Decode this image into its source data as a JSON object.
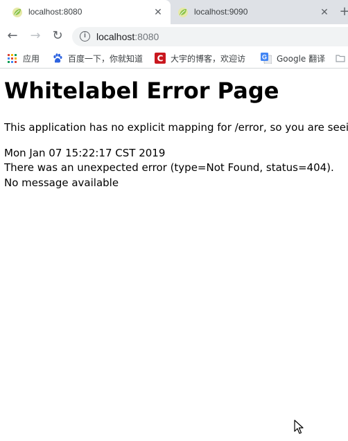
{
  "tabs": [
    {
      "title": "localhost:8080",
      "active": true,
      "icon": "spring-leaf-icon"
    },
    {
      "title": "localhost:9090",
      "active": false,
      "icon": "spring-leaf-icon"
    }
  ],
  "tab_close_glyph": "✕",
  "new_tab_glyph": "+",
  "toolbar": {
    "back_glyph": "←",
    "forward_glyph": "→",
    "reload_glyph": "↻",
    "info_glyph": "i",
    "url_host": "localhost",
    "url_port": ":8080"
  },
  "bookmarks": [
    {
      "label": "应用",
      "icon": "apps-grid-icon"
    },
    {
      "label": "百度一下，你就知道",
      "icon": "baidu-paw-icon"
    },
    {
      "label": "大宇的博客，欢迎访",
      "icon": "csdn-icon"
    },
    {
      "label": "Google 翻译",
      "icon": "google-translate-icon"
    }
  ],
  "page": {
    "heading": "Whitelabel Error Page",
    "description": "This application has no explicit mapping for /error, so you are seeing this as a fallback.",
    "timestamp": "Mon Jan 07 15:22:17 CST 2019",
    "error_line": "There was an unexpected error (type=Not Found, status=404).",
    "message": "No message available"
  },
  "colors": {
    "tab_strip": "#dee1e6",
    "omnibox": "#f1f3f4",
    "spring_green": "#8bc34a"
  }
}
